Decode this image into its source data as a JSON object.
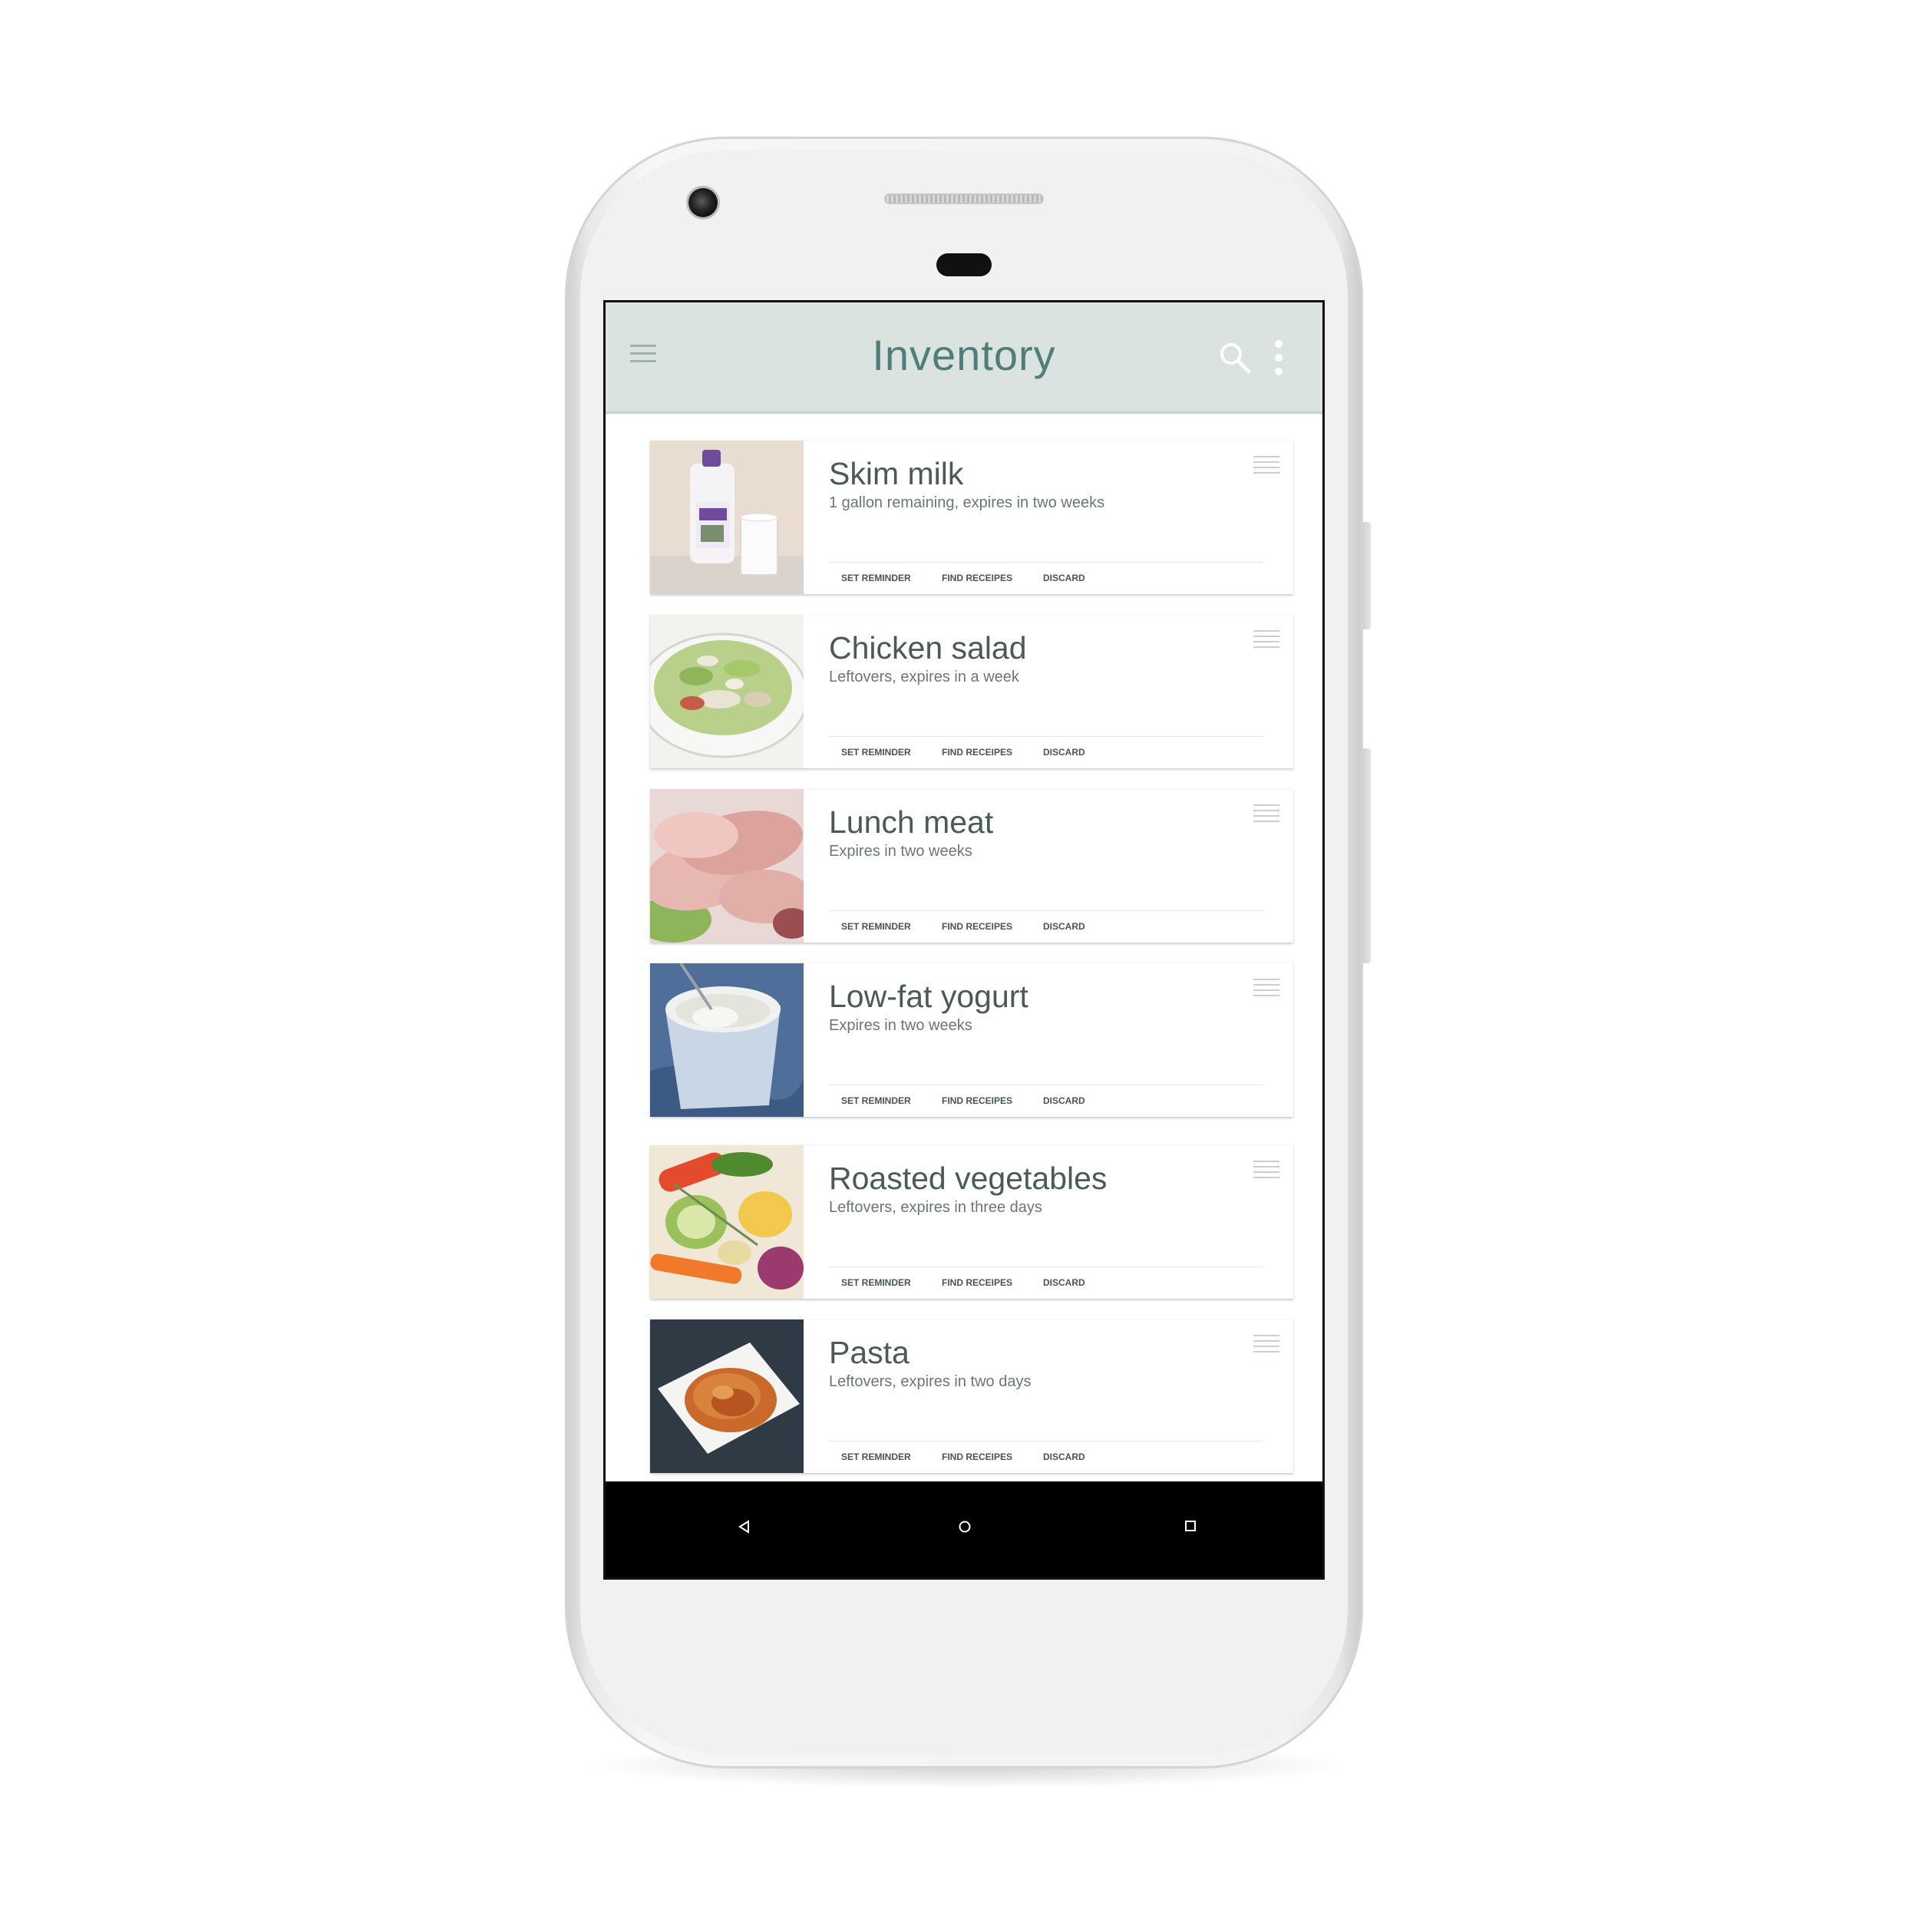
{
  "app_bar": {
    "title": "Inventory",
    "icons": [
      "menu-icon",
      "search-icon",
      "overflow-menu-icon"
    ],
    "background": "#dbe3e1",
    "title_color": "#4f7e79"
  },
  "actions": {
    "set_reminder": "SET REMINDER",
    "find_recipes": "FIND RECEIPES",
    "discard": "DISCARD"
  },
  "items": [
    {
      "title": "Skim milk",
      "subtitle": "1 gallon remaining, expires in two weeks",
      "image": "milk-jug-and-glass"
    },
    {
      "title": "Chicken salad",
      "subtitle": "Leftovers, expires in a week",
      "image": "chicken-salad-bowl"
    },
    {
      "title": "Lunch meat",
      "subtitle": "Expires in two weeks",
      "image": "sliced-ham"
    },
    {
      "title": "Low-fat yogurt",
      "subtitle": "Expires in two weeks",
      "image": "yogurt-cup"
    },
    {
      "title": "Roasted vegetables",
      "subtitle": "Leftovers, expires in three days",
      "image": "roasted-vegetables"
    },
    {
      "title": "Pasta",
      "subtitle": "Leftovers, expires in two days",
      "image": "spaghetti-plate"
    }
  ],
  "nav_bar": {
    "icons": [
      "back-icon",
      "home-icon",
      "recents-icon"
    ]
  }
}
